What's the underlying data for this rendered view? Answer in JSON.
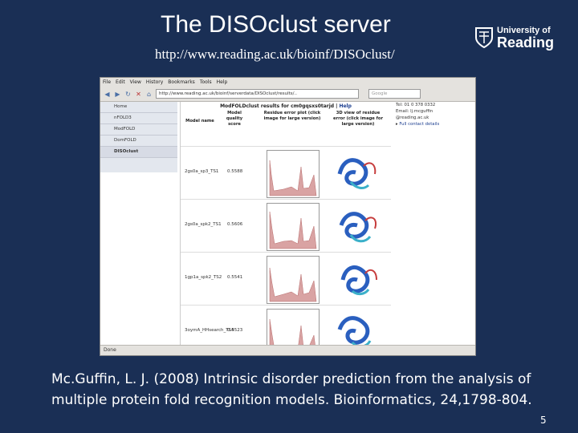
{
  "slide": {
    "title": "The DISOclust server",
    "url": "http://www.reading.ac.uk/bioinf/DISOclust/",
    "citation": "Mc.Guffin, L. J. (2008) Intrinsic disorder prediction from the analysis of multiple protein fold recognition models. Bioinformatics, 24,1798-804.",
    "page_number": "5",
    "logo": {
      "line1": "University of",
      "line2": "Reading",
      "icon": "university-crest-icon"
    }
  },
  "browser": {
    "menu": [
      "File",
      "Edit",
      "View",
      "History",
      "Bookmarks",
      "Tools",
      "Help"
    ],
    "toolbar_icons": [
      "back-icon",
      "forward-icon",
      "reload-icon",
      "stop-icon",
      "home-icon"
    ],
    "address": "http://www.reading.ac.uk/bioinf/serverdata/DISOclust/results/..",
    "search_placeholder": "Google",
    "status": "Done",
    "nav": [
      "Home",
      "nFOLD3",
      "ModFOLD",
      "DomFOLD",
      "DISOclust"
    ],
    "selected_nav": "DISOclust",
    "results_title": "ModFOLDclust results for cm0gqsxs0tarjd",
    "help_link": "Help",
    "columns": [
      "Model name",
      "Model quality score",
      "Residue error plot (click image for large version)",
      "3D view of residue error (click image for large version)"
    ],
    "rows": [
      {
        "model": "2gs0a_sp3_TS1",
        "score": "0.5588"
      },
      {
        "model": "2gs0a_spk2_TS1",
        "score": "0.5606"
      },
      {
        "model": "1gp1a_spk2_TS2",
        "score": "0.5541"
      },
      {
        "model": "3oymA_HHsearch_TS4",
        "score": "0.5523"
      }
    ],
    "contact": {
      "tel": "Tel: 01 0 378 0332",
      "email_label": "Email: lj.mcguffin",
      "email_domain": "@reading.ac.uk",
      "details_link": "Full contact details"
    }
  }
}
